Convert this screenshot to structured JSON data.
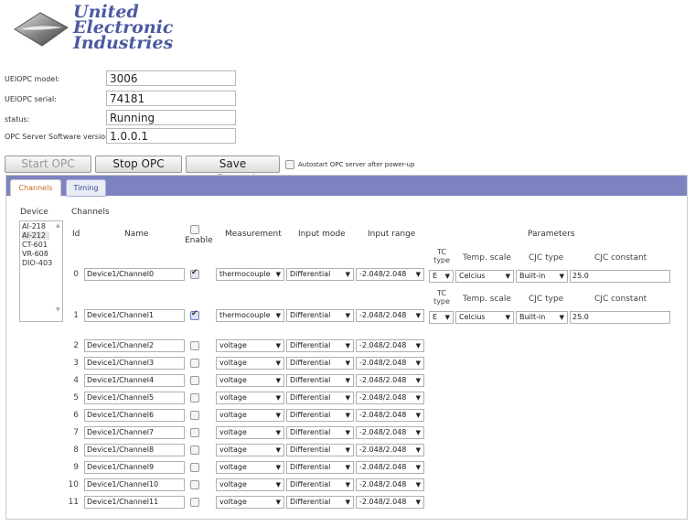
{
  "logo": {
    "line1": "United",
    "line2": "Electronic",
    "line3": "Industries"
  },
  "info": [
    {
      "label": "UEIOPC model:",
      "value": "3006"
    },
    {
      "label": "UEIOPC serial:",
      "value": "74181"
    },
    {
      "label": "status:",
      "value": "Running"
    },
    {
      "label": "OPC Server Software version:",
      "value": "1.0.0.1"
    }
  ],
  "toolbar": {
    "start_label": "Start OPC server",
    "stop_label": "Stop OPC server",
    "save_label": "Save configuration",
    "autostart_label": "Autostart OPC server after power-up",
    "autostart_checked": false
  },
  "tabs": [
    {
      "label": "Channels",
      "active": true
    },
    {
      "label": "Timing",
      "active": false
    }
  ],
  "headers": {
    "device": "Device",
    "channels": "Channels",
    "id": "Id",
    "name": "Name",
    "enable": "Enable",
    "measurement": "Measurement",
    "input_mode": "Input mode",
    "input_range": "Input range",
    "parameters": "Parameters"
  },
  "devices": [
    "AI-218",
    "AI-212",
    "CT-601",
    "VR-608",
    "DIO-403"
  ],
  "selected_device": "AI-212",
  "param_labels": {
    "tc_type": "TC type",
    "temp_scale": "Temp. scale",
    "cjc_type": "CJC type",
    "cjc_constant": "CJC constant"
  },
  "channels": [
    {
      "id": "0",
      "name": "Device1/Channel0",
      "enabled": true,
      "measurement": "thermocouple",
      "input_mode": "Differential",
      "input_range": "-2.048/2.048",
      "tc_type": "E",
      "temp_scale": "Celcius",
      "cjc_type": "Built-in",
      "cjc_constant": "25.0"
    },
    {
      "id": "1",
      "name": "Device1/Channel1",
      "enabled": true,
      "measurement": "thermocouple",
      "input_mode": "Differential",
      "input_range": "-2.048/2.048",
      "tc_type": "E",
      "temp_scale": "Celcius",
      "cjc_type": "Built-in",
      "cjc_constant": "25.0"
    },
    {
      "id": "2",
      "name": "Device1/Channel2",
      "enabled": false,
      "measurement": "voltage",
      "input_mode": "Differential",
      "input_range": "-2.048/2.048"
    },
    {
      "id": "3",
      "name": "Device1/Channel3",
      "enabled": false,
      "measurement": "voltage",
      "input_mode": "Differential",
      "input_range": "-2.048/2.048"
    },
    {
      "id": "4",
      "name": "Device1/Channel4",
      "enabled": false,
      "measurement": "voltage",
      "input_mode": "Differential",
      "input_range": "-2.048/2.048"
    },
    {
      "id": "5",
      "name": "Device1/Channel5",
      "enabled": false,
      "measurement": "voltage",
      "input_mode": "Differential",
      "input_range": "-2.048/2.048"
    },
    {
      "id": "6",
      "name": "Device1/Channel6",
      "enabled": false,
      "measurement": "voltage",
      "input_mode": "Differential",
      "input_range": "-2.048/2.048"
    },
    {
      "id": "7",
      "name": "Device1/Channel7",
      "enabled": false,
      "measurement": "voltage",
      "input_mode": "Differential",
      "input_range": "-2.048/2.048"
    },
    {
      "id": "8",
      "name": "Device1/Channel8",
      "enabled": false,
      "measurement": "voltage",
      "input_mode": "Differential",
      "input_range": "-2.048/2.048"
    },
    {
      "id": "9",
      "name": "Device1/Channel9",
      "enabled": false,
      "measurement": "voltage",
      "input_mode": "Differential",
      "input_range": "-2.048/2.048"
    },
    {
      "id": "10",
      "name": "Device1/Channel10",
      "enabled": false,
      "measurement": "voltage",
      "input_mode": "Differential",
      "input_range": "-2.048/2.048"
    },
    {
      "id": "11",
      "name": "Device1/Channel11",
      "enabled": false,
      "measurement": "voltage",
      "input_mode": "Differential",
      "input_range": "-2.048/2.048"
    }
  ],
  "colors": {
    "tab_bar": "#7d83c0",
    "logo_text": "#4b5aa0",
    "active_tab_text": "#c96c1c"
  }
}
